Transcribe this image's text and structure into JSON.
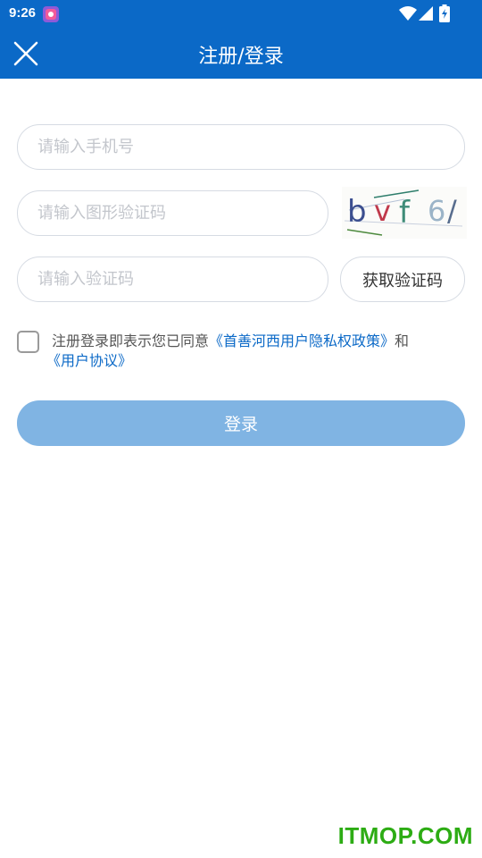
{
  "status_bar": {
    "time": "9:26"
  },
  "header": {
    "title": "注册/登录"
  },
  "form": {
    "phone_placeholder": "请输入手机号",
    "captcha_placeholder": "请输入图形验证码",
    "captcha_text": "bvf6/",
    "sms_placeholder": "请输入验证码",
    "get_code_label": "获取验证码"
  },
  "agreement": {
    "text": "注册登录即表示您已同意",
    "privacy_link": "《首善河西用户隐私权政策》",
    "connector": "和",
    "user_link": "《用户协议》"
  },
  "login_button": {
    "label": "登录"
  },
  "watermark": {
    "text": "ITMOP.COM"
  },
  "colors": {
    "header_bg": "#0b69c7",
    "button_disabled": "#80b4e3",
    "link": "#0b69c7",
    "watermark": "#2dac14"
  }
}
